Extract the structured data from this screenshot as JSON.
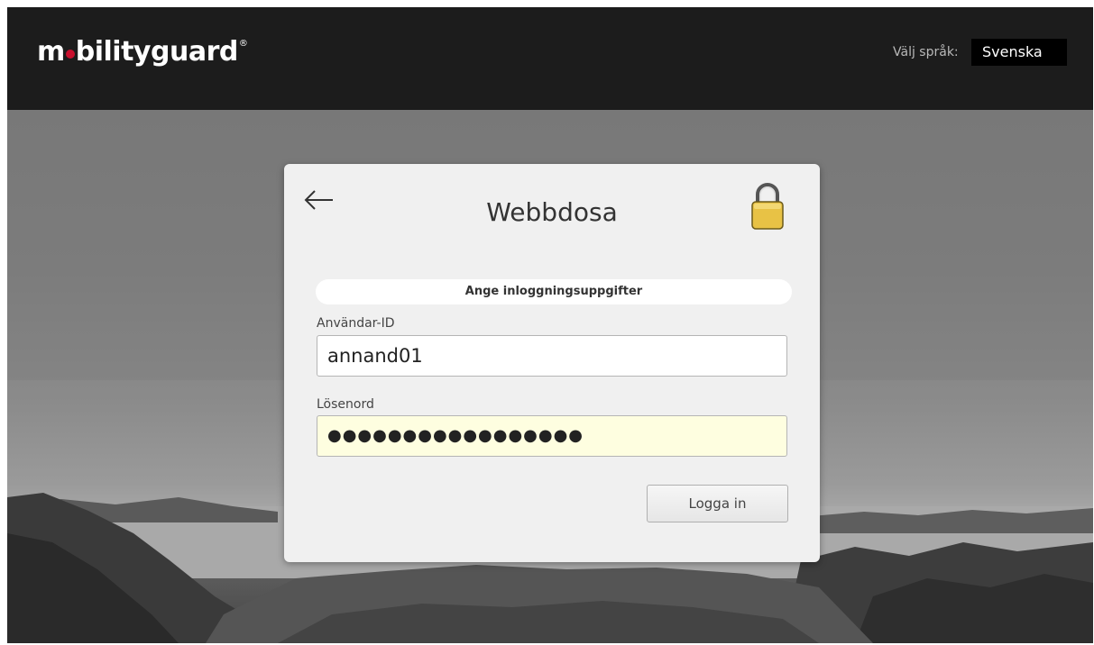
{
  "header": {
    "logo_left": "m",
    "logo_right": "bilityguard",
    "logo_mark": "®",
    "language_label": "Välj språk:",
    "language_selected": "Svenska"
  },
  "login": {
    "title": "Webbdosa",
    "info_text": "Ange inloggningsuppgifter",
    "user_label": "Användar-ID",
    "user_value": "annand01",
    "password_label": "Lösenord",
    "password_masked": "●●●●●●●●●●●●●●●●●",
    "submit_label": "Logga in"
  },
  "icons": {
    "back": "arrow-left-icon",
    "lock": "padlock-icon"
  },
  "colors": {
    "header_bg": "#1c1c1c",
    "logo_dot": "#c8102e",
    "card_bg": "#f0f0f0",
    "password_field_bg": "#fefee0",
    "lock_body": "#e8c245"
  }
}
